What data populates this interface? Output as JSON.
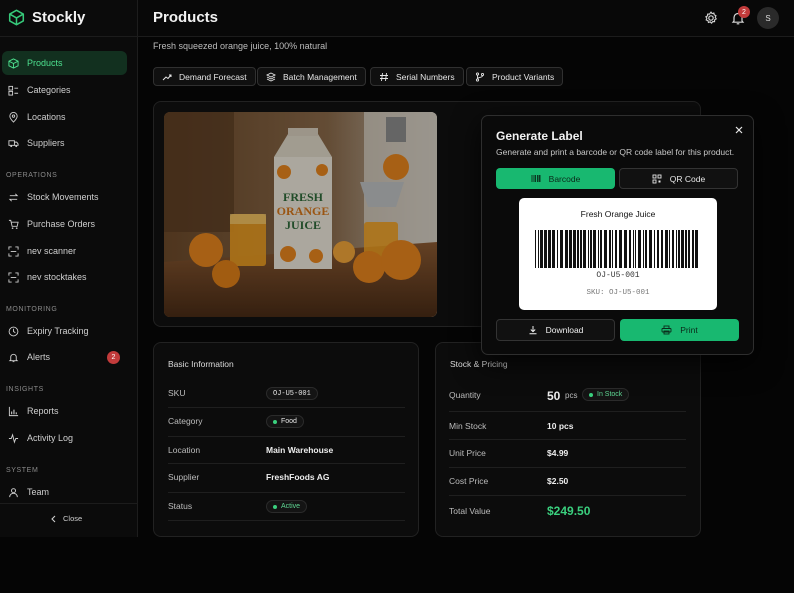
{
  "app": {
    "name": "Stockly"
  },
  "header": {
    "title": "Products",
    "notification_count": "2",
    "avatar_initial": "S"
  },
  "sidebar": {
    "items": [
      {
        "label": "Products",
        "icon": "box-icon",
        "active": true
      },
      {
        "label": "Categories",
        "icon": "layers-icon"
      },
      {
        "label": "Locations",
        "icon": "pin-icon"
      },
      {
        "label": "Suppliers",
        "icon": "truck-icon"
      }
    ],
    "sections": {
      "operations": {
        "title": "OPERATIONS",
        "items": [
          {
            "label": "Stock Movements",
            "icon": "arrows-icon"
          },
          {
            "label": "Purchase Orders",
            "icon": "cart-icon"
          },
          {
            "label": "nev scanner",
            "icon": "scan-icon"
          },
          {
            "label": "nev stocktakes",
            "icon": "scan-icon"
          }
        ]
      },
      "monitoring": {
        "title": "MONITORING",
        "items": [
          {
            "label": "Expiry Tracking",
            "icon": "clock-icon"
          },
          {
            "label": "Alerts",
            "icon": "bell-icon",
            "badge": "2"
          }
        ]
      },
      "insights": {
        "title": "INSIGHTS",
        "items": [
          {
            "label": "Reports",
            "icon": "chart-icon"
          },
          {
            "label": "Activity Log",
            "icon": "activity-icon"
          }
        ]
      },
      "system": {
        "title": "SYSTEM",
        "items": [
          {
            "label": "Team",
            "icon": "users-icon"
          }
        ]
      }
    },
    "close_label": "Close"
  },
  "product": {
    "subtitle": "Fresh squeezed orange juice, 100% natural",
    "tabs": [
      {
        "label": "Demand Forecast",
        "icon": "trend-icon"
      },
      {
        "label": "Batch Management",
        "icon": "stack-icon"
      },
      {
        "label": "Serial Numbers",
        "icon": "hash-icon"
      },
      {
        "label": "Product Variants",
        "icon": "branch-icon"
      }
    ],
    "image_alt": "Fresh Orange Juice carton with oranges"
  },
  "basic_info": {
    "title": "Basic Information",
    "sku_label": "SKU",
    "sku": "OJ-U5-001",
    "category_label": "Category",
    "category": "Food",
    "location_label": "Location",
    "location": "Main Warehouse",
    "supplier_label": "Supplier",
    "supplier": "FreshFoods AG",
    "status_label": "Status",
    "status": "Active"
  },
  "stock_pricing": {
    "title": "Stock & Pricing",
    "quantity_label": "Quantity",
    "quantity": "50",
    "quantity_unit": "pcs",
    "stock_status": "In Stock",
    "min_stock_label": "Min Stock",
    "min_stock": "10 pcs",
    "unit_price_label": "Unit Price",
    "unit_price": "$4.99",
    "cost_price_label": "Cost Price",
    "cost_price": "$2.50",
    "total_value_label": "Total Value",
    "total_value": "$249.50"
  },
  "dialog": {
    "title": "Generate Label",
    "description": "Generate and print a barcode or QR code label for this product.",
    "barcode_tab": "Barcode",
    "qr_tab": "QR Code",
    "label_name": "Fresh Orange Juice",
    "code": "OJ-U5-001",
    "sku_line": "SKU: OJ-U5-001",
    "download_label": "Download",
    "print_label": "Print"
  },
  "colors": {
    "accent": "#18b870",
    "accent_text": "#4ee08f",
    "danger": "#c23b3b",
    "background": "#050505"
  }
}
